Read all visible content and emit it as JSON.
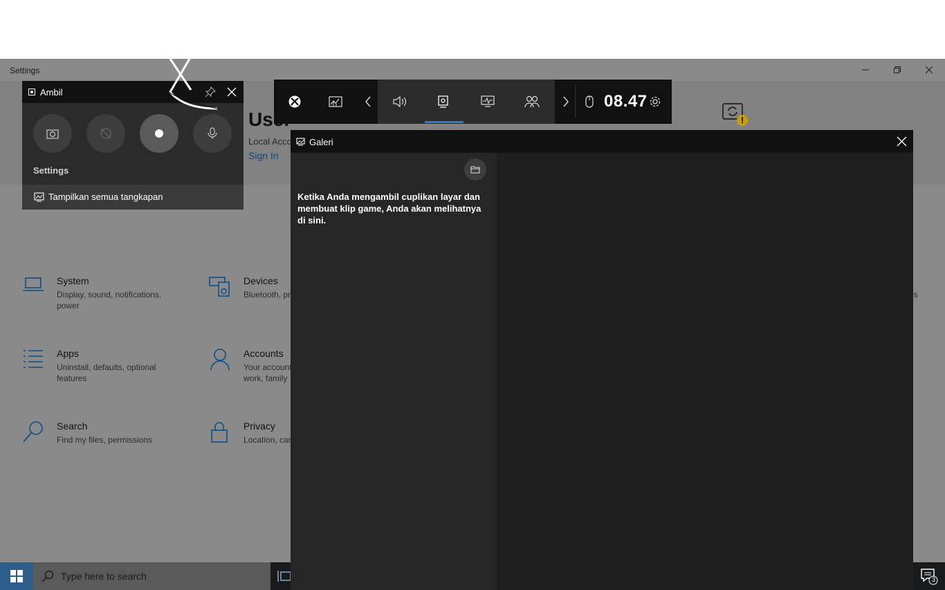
{
  "settings_window": {
    "title": "Settings",
    "user": {
      "title": "User",
      "subtitle": "Local Acco",
      "sign_in": "Sign In"
    },
    "categories": [
      {
        "name": "System",
        "desc": "Display, sound, notifications, power",
        "icon": "laptop-icon"
      },
      {
        "name": "Devices",
        "desc": "Bluetooth, pr",
        "icon": "keyboard-speaker-icon"
      },
      {
        "name": "Apps",
        "desc": "Uninstall, defaults, optional features",
        "icon": "list-icon"
      },
      {
        "name": "Accounts",
        "desc": "Your account\nwork, family",
        "icon": "person-icon"
      },
      {
        "name": "Search",
        "desc": "Find my files, permissions",
        "icon": "search-icon"
      },
      {
        "name": "Privacy",
        "desc": "Location, car",
        "icon": "lock-icon"
      }
    ],
    "edge_text": "ers"
  },
  "capture_widget": {
    "title": "Ambil",
    "settings_label": "Settings",
    "show_all": "Tampilkan semua tangkapan"
  },
  "gamebar": {
    "time": "08.47"
  },
  "gallery": {
    "title": "Galeri",
    "empty_message": "Ketika Anda mengambil cuplikan layar dan membuat klip game, Anda akan melihatnya di sini."
  },
  "taskbar": {
    "search_placeholder": "Type here to search",
    "notification_count": "3"
  },
  "colors": {
    "accent": "#2d7dd2",
    "warning": "#f2c200",
    "link": "#064a7e"
  }
}
